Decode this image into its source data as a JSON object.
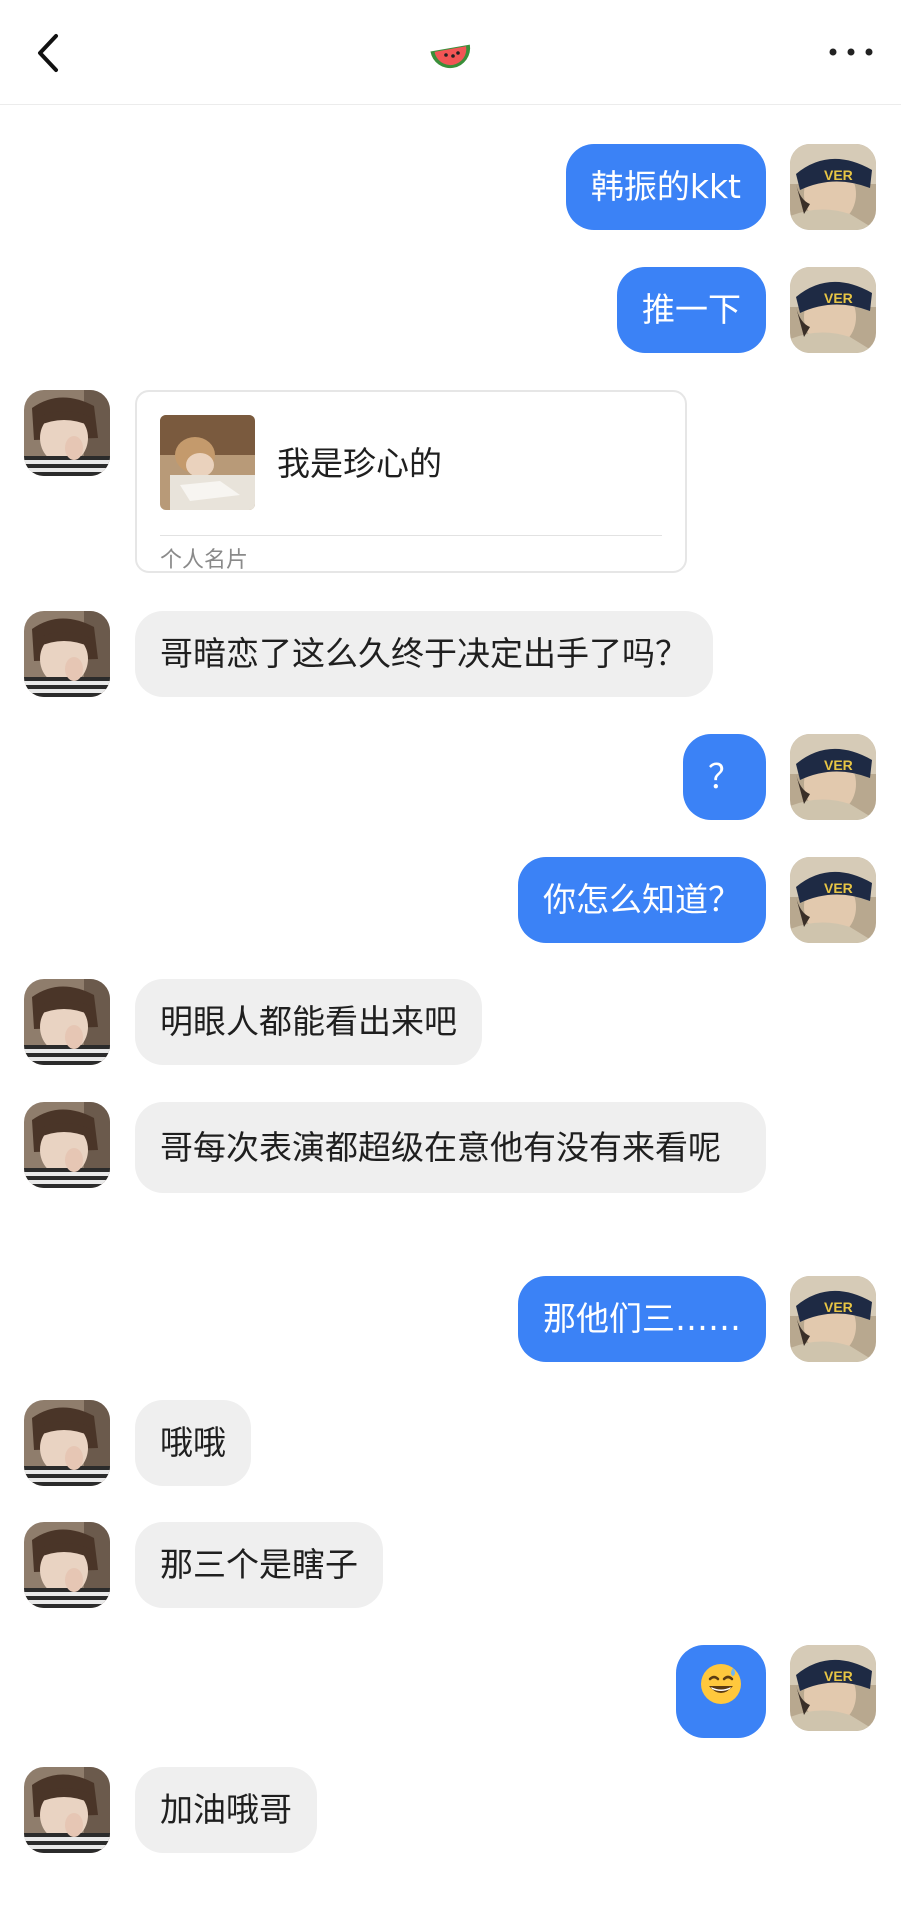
{
  "header": {
    "back_icon": "chevron-left-icon",
    "title_icon": "watermelon-icon",
    "more_icon": "more-horizontal-icon"
  },
  "colors": {
    "sent_bubble": "#3b82f6",
    "received_bubble": "#efefef",
    "background": "#ffffff"
  },
  "messages": [
    {
      "from": "me",
      "text": "韩振的kkt"
    },
    {
      "from": "me",
      "text": "推一下"
    },
    {
      "from": "them",
      "type": "contact_card",
      "name": "我是珍心的",
      "label": "个人名片"
    },
    {
      "from": "them",
      "text": "哥暗恋了这么久终于决定出手了吗？"
    },
    {
      "from": "me",
      "text": "？"
    },
    {
      "from": "me",
      "text": "你怎么知道？"
    },
    {
      "from": "them",
      "text": "明眼人都能看出来吧"
    },
    {
      "from": "them",
      "text": "哥每次表演都超级在意他有没有来看呢"
    },
    {
      "from": "me",
      "text": "那他们三……"
    },
    {
      "from": "them",
      "text": "哦哦"
    },
    {
      "from": "them",
      "text": "那三个是瞎子"
    },
    {
      "from": "me",
      "type": "emoji",
      "icon": "sweat-smile-emoji"
    },
    {
      "from": "them",
      "text": "加油哦哥"
    }
  ]
}
